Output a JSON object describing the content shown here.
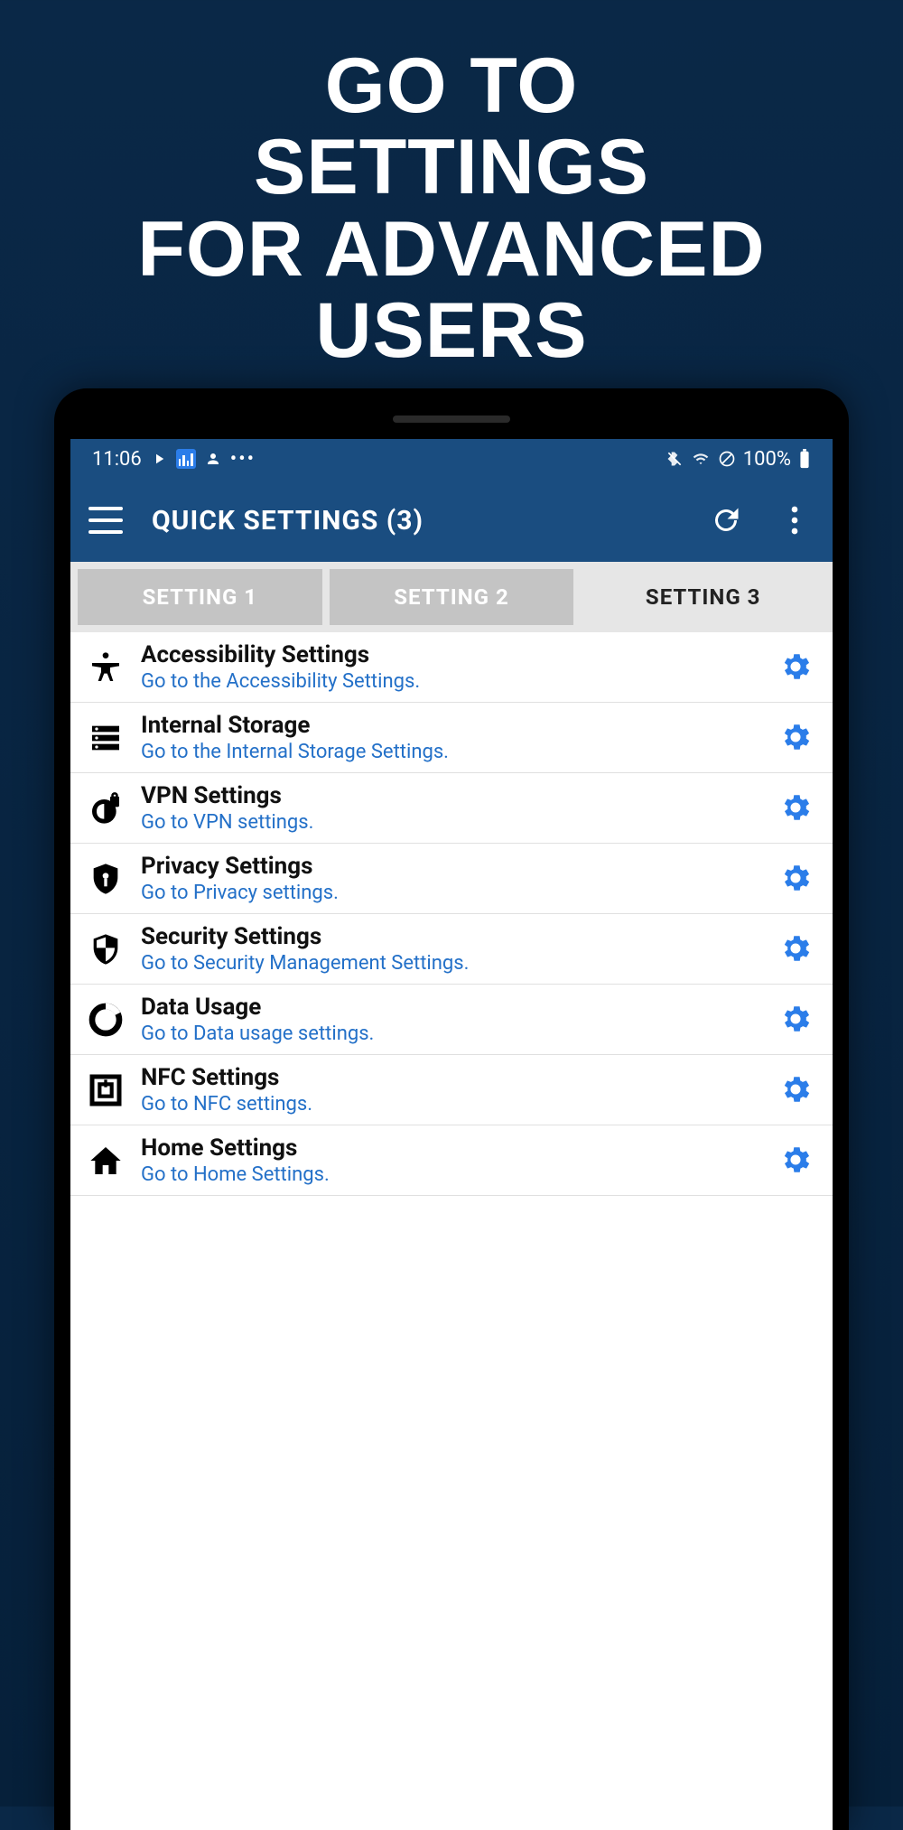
{
  "promo": {
    "line1": "GO TO",
    "line2": "SETTINGS",
    "line3": "FOR ADVANCED USERS"
  },
  "status_bar": {
    "time": "11:06",
    "battery": "100%"
  },
  "app_bar": {
    "title": "QUICK SETTINGS (3)"
  },
  "tabs": [
    {
      "label": "SETTING 1",
      "active": false
    },
    {
      "label": "SETTING 2",
      "active": false
    },
    {
      "label": "SETTING 3",
      "active": true
    }
  ],
  "settings": [
    {
      "icon": "accessibility",
      "title": "Accessibility Settings",
      "sub": "Go to the Accessibility Settings."
    },
    {
      "icon": "storage",
      "title": "Internal Storage",
      "sub": "Go to the Internal Storage Settings."
    },
    {
      "icon": "vpn",
      "title": "VPN Settings",
      "sub": "Go to VPN settings."
    },
    {
      "icon": "privacy",
      "title": "Privacy Settings",
      "sub": "Go to Privacy settings."
    },
    {
      "icon": "security",
      "title": "Security Settings",
      "sub": "Go to Security Management Settings."
    },
    {
      "icon": "data",
      "title": "Data Usage",
      "sub": "Go to Data usage settings."
    },
    {
      "icon": "nfc",
      "title": "NFC Settings",
      "sub": "Go to NFC settings."
    },
    {
      "icon": "home",
      "title": "Home Settings",
      "sub": "Go to Home Settings."
    }
  ],
  "colors": {
    "header": "#1a4d80",
    "accent": "#2b7de9",
    "link": "#2370c8"
  }
}
